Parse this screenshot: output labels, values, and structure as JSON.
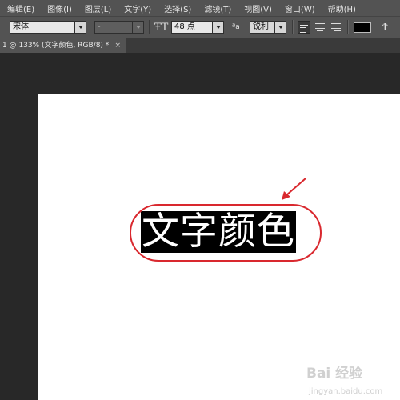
{
  "menu": {
    "items": [
      "编辑(E)",
      "图像(I)",
      "图层(L)",
      "文字(Y)",
      "选择(S)",
      "滤镜(T)",
      "视图(V)",
      "窗口(W)",
      "帮助(H)"
    ]
  },
  "options": {
    "font_family": "宋体",
    "font_style": "-",
    "font_size": "48 点",
    "antialias_icon_label": "ªa",
    "antialias": "锐利",
    "text_color": "#000000"
  },
  "tab": {
    "title": "1 @ 133% (文字颜色, RGB/8) *",
    "close": "×"
  },
  "canvas": {
    "text": "文字颜色",
    "highlight_color": "#d9282e"
  },
  "watermark": {
    "main": "Bai 经验",
    "sub": "jingyan.baidu.com"
  }
}
